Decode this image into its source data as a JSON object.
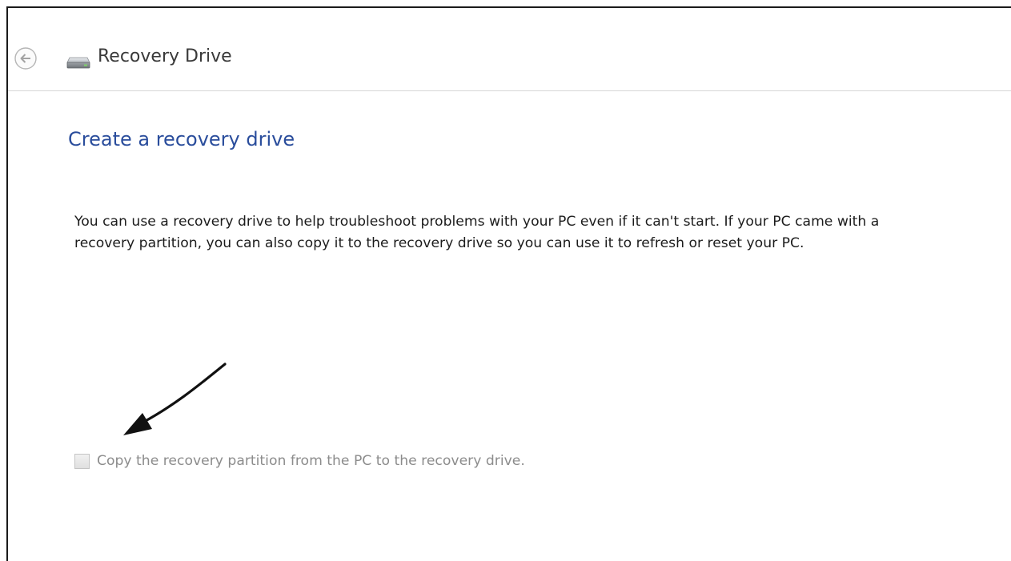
{
  "window": {
    "title": "Recovery Drive",
    "back_icon": "back-arrow-circle-icon",
    "drive_icon": "hard-drive-icon"
  },
  "main": {
    "heading": "Create a recovery drive",
    "description": "You can use a recovery drive to help troubleshoot problems with your PC even if it can't start. If your PC came with a recovery partition, you can also copy it to the recovery drive so you can use it to refresh or reset your PC.",
    "copy_partition": {
      "label": "Copy the recovery partition from the PC to the recovery drive.",
      "checked": false,
      "enabled": false
    }
  },
  "annotation": {
    "icon": "pointer-arrow-icon"
  },
  "colors": {
    "heading": "#2a4d9c",
    "body_text": "#1c1c1c",
    "disabled_text": "#8c8c8c",
    "window_border": "#1a1a1a"
  }
}
